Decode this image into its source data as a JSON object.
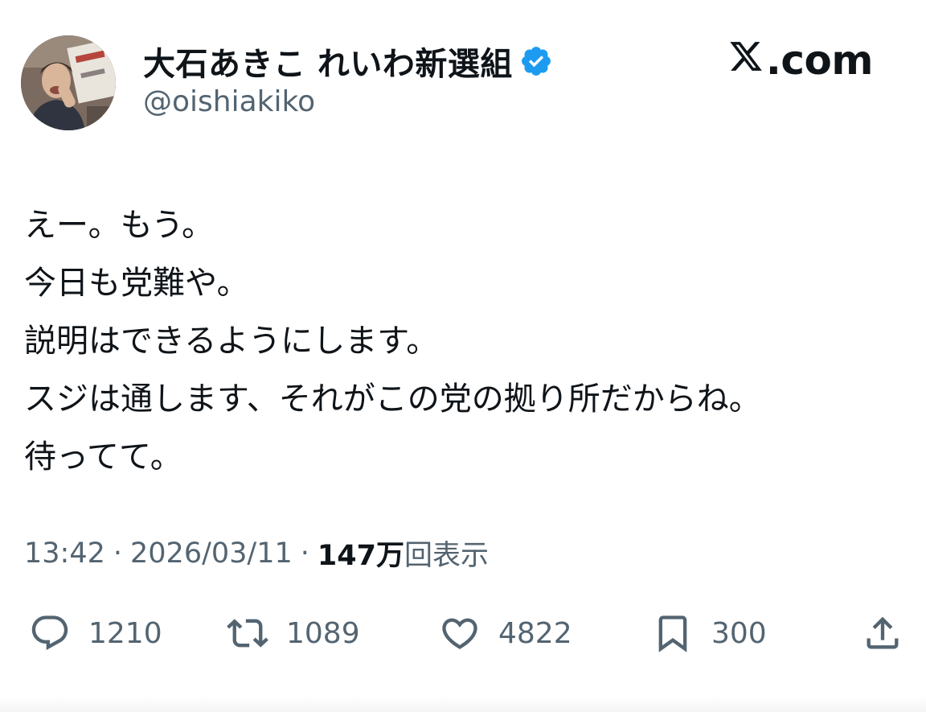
{
  "user": {
    "display_name": "大石あきこ れいわ新選組",
    "handle": "@oishiakiko",
    "verified_icon": "verified-badge-icon",
    "verified_color": "#1d9bf0"
  },
  "brand": {
    "label": ".com",
    "icon": "x-logo-icon"
  },
  "tweet": {
    "lines": [
      "えー。もう。",
      "今日も党難や。",
      "説明はできるようにします。",
      "スジは通します、それがこの党の拠り所だからね。",
      "待ってて。"
    ]
  },
  "meta": {
    "time": "13:42",
    "separator": "·",
    "date": "2026/03/11",
    "views_count": "147万",
    "views_label": "回表示"
  },
  "actions": {
    "reply": {
      "icon": "reply-icon",
      "count": "1210"
    },
    "retweet": {
      "icon": "retweet-icon",
      "count": "1089"
    },
    "like": {
      "icon": "heart-icon",
      "count": "4822"
    },
    "bookmark": {
      "icon": "bookmark-icon",
      "count": "300"
    },
    "share": {
      "icon": "share-icon"
    }
  },
  "colors": {
    "text_primary": "#0f1419",
    "text_secondary": "#536471",
    "accent": "#1d9bf0"
  }
}
